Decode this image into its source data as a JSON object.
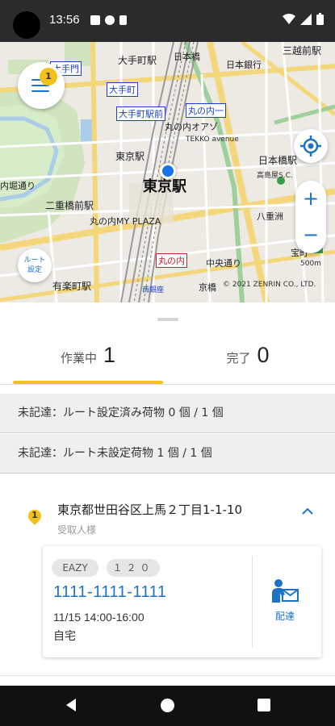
{
  "status_bar": {
    "time": "13:56"
  },
  "map": {
    "labels": {
      "otemachi_sta": "大手町駅",
      "nihombashi": "日本橋",
      "mitsukoshimae": "三越前駅",
      "nihon_ginko": "日本銀行",
      "otemon": "大手門",
      "otemachi": "大手町",
      "otemachi_eki_mae": "大手町駅前",
      "marunouchi_1": "丸の内一",
      "marunouchi_oazo": "丸の内オアゾ",
      "tekko": "TEKKO avenue",
      "tokyo_eki": "東京駅",
      "tokyo_sta_big": "東京駅",
      "nihombashi_sta": "日本橋駅",
      "takashimaya": "高島屋S.C.",
      "uchibori": "内堀通り",
      "nijubashi": "二重橋前駅",
      "yaesu": "八重洲",
      "marunouchi_my_plaza": "丸の内MY PLAZA",
      "marunouchi": "丸の内",
      "chuo_dori": "中央通り",
      "hoken": "宝町",
      "yurakucho": "有楽町駅",
      "nishi_ginza": "西銀座",
      "kyobashi": "京橋",
      "copyright": "© 2021 ZENRIN CO., LTD.",
      "scale": "500m"
    },
    "menu_badge": "1",
    "route_button_label_1": "ルート",
    "route_button_label_2": "設定",
    "zoom_in": "+",
    "zoom_out": "−"
  },
  "tabs": {
    "active": {
      "label": "作業中",
      "count": "1"
    },
    "done": {
      "label": "完了",
      "count": "0"
    }
  },
  "summary": {
    "route_set": "未記達：ルート設定済み荷物 0 個 / 1 個",
    "route_unset": "未記達：ルート未設定荷物 1 個 / 1 個"
  },
  "delivery": {
    "order": "1",
    "address": "東京都世田谷区上馬２丁目1-1-10",
    "recipient": "受取人様",
    "chips": [
      "EAZY",
      "１２０"
    ],
    "tracking_number": "1111-1111-1111",
    "time_slot": "11/15 14:00-16:00",
    "place": "自宅",
    "action_label": "配達"
  },
  "colors": {
    "accent": "#1a73c7",
    "badge": "#f2c21a",
    "tab_underline": "#f2c21a"
  },
  "icons": {
    "menu": "hamburger-menu-icon",
    "locate": "my-location-icon",
    "chevron": "chevron-up-icon",
    "deliver": "delivery-person-icon"
  }
}
